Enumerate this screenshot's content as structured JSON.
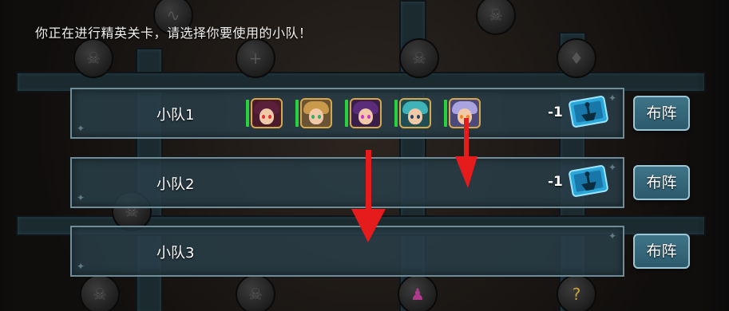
{
  "prompt_text": "你正在进行精英关卡，请选择你要使用的小队！",
  "teams": [
    {
      "name": "小队1",
      "heroes": [
        {
          "icon": "hero-portrait-dark-hair-girl",
          "hair": "#5a1f3a",
          "eyes": "#d33"
        },
        {
          "icon": "hero-portrait-blonde-warrior",
          "hair": "#c99a4a",
          "eyes": "#3a6"
        },
        {
          "icon": "hero-portrait-purple-hair-mage",
          "hair": "#5b2c7a",
          "eyes": "#c3c"
        },
        {
          "icon": "hero-portrait-teal-hair-boy",
          "hair": "#3fb3b8",
          "eyes": "#246"
        },
        {
          "icon": "hero-portrait-lavender-hair-girl",
          "hair": "#a9a3e0",
          "eyes": "#e82"
        }
      ],
      "cost": "-1",
      "ticket_icon": "stamina-ticket-icon",
      "button_label": "布阵"
    },
    {
      "name": "小队2",
      "heroes": [],
      "cost": "-1",
      "ticket_icon": "stamina-ticket-icon",
      "button_label": "布阵"
    },
    {
      "name": "小队3",
      "heroes": [],
      "cost": "",
      "ticket_icon": "",
      "button_label": "布阵"
    }
  ],
  "colors": {
    "row_border": "#6f8d98",
    "button_bg": "#3f7488",
    "hero_health_bar": "#2ad13f",
    "annotation_arrow": "#e61b1b"
  }
}
